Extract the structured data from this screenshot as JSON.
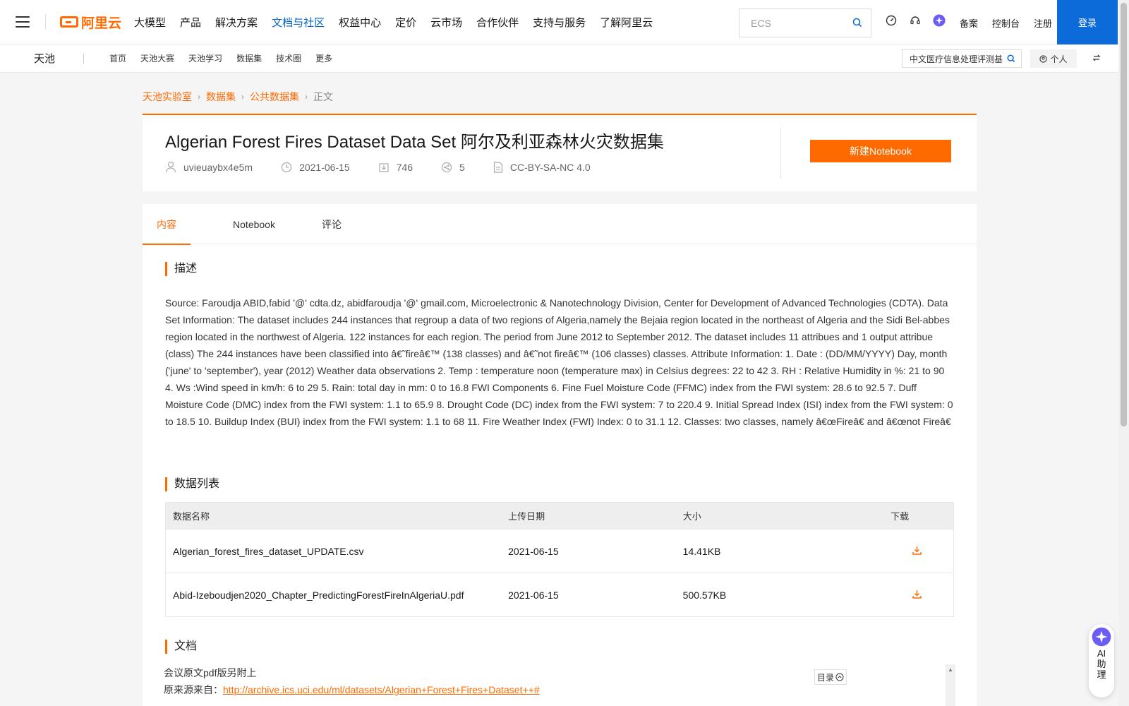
{
  "topnav": {
    "logo_text": "阿里云",
    "items": [
      "大模型",
      "产品",
      "解决方案",
      "文档与社区",
      "权益中心",
      "定价",
      "云市场",
      "合作伙伴",
      "支持与服务",
      "了解阿里云"
    ],
    "search_placeholder": "ECS",
    "links": [
      "备案",
      "控制台",
      "注册"
    ],
    "login_label": "登录"
  },
  "subnav": {
    "brand": "天池",
    "items": [
      "首页",
      "天池大赛",
      "天池学习",
      "数据集",
      "技术圈",
      "更多"
    ],
    "search_value": "中文医疗信息处理评测基",
    "personal_label": "个人"
  },
  "breadcrumb": [
    "天池实验室",
    "数据集",
    "公共数据集",
    "正文"
  ],
  "dataset": {
    "title": "Algerian Forest Fires Dataset Data Set 阿尔及利亚森林火灾数据集",
    "author": "uvieuaybx4e5m",
    "date": "2021-06-15",
    "downloads": "746",
    "shares": "5",
    "license": "CC-BY-SA-NC 4.0",
    "notebook_label": "新建Notebook"
  },
  "tabs": [
    "内容",
    "Notebook",
    "评论"
  ],
  "sections": {
    "description_title": "描述",
    "description_text": "  Source: Faroudja ABID,fabid '@' cdta.dz, abidfaroudja '@' gmail.com, Microelectronic & Nanotechnology Division, Center for Development of Advanced Technologies (CDTA). Data Set Information: The dataset includes 244 instances that regroup a data of two regions of Algeria,namely the Bejaia region located in the northeast of Algeria and the Sidi Bel-abbes region located in the northwest of Algeria. 122 instances for each region. The period from June 2012 to September 2012. The dataset includes 11 attribues and 1 output attribue (class) The 244 instances have been classified into â€˜fireâ€™ (138 classes) and â€˜not fireâ€™ (106 classes) classes. Attribute Information: 1. Date : (DD/MM/YYYY) Day, month ('june' to 'september'), year (2012) Weather data observations 2. Temp : temperature noon (temperature max) in Celsius degrees: 22 to 42 3. RH : Relative Humidity in %: 21 to 90 4. Ws :Wind speed in km/h: 6 to 29 5. Rain: total day in mm: 0 to 16.8 FWI Components 6. Fine Fuel Moisture Code (FFMC) index from the FWI system: 28.6 to 92.5 7. Duff Moisture Code (DMC) index from the FWI system: 1.1 to 65.9 8. Drought Code (DC) index from the FWI system: 7 to 220.4 9. Initial Spread Index (ISI) index from the FWI system: 0 to 18.5 10. Buildup Index (BUI) index from the FWI system: 1.1 to 68 11. Fire Weather Index (FWI) Index: 0 to 31.1 12. Classes: two classes, namely â€œFireâ€ and â€œnot Fireâ€",
    "datalist_title": "数据列表",
    "docs_title": "文档"
  },
  "table": {
    "headers": [
      "数据名称",
      "上传日期",
      "大小",
      "下载"
    ],
    "rows": [
      {
        "name": "Algerian_forest_fires_dataset_UPDATE.csv",
        "date": "2021-06-15",
        "size": "14.41KB"
      },
      {
        "name": "Abid-Izeboudjen2020_Chapter_PredictingForestFireInAlgeriaU.pdf",
        "date": "2021-06-15",
        "size": "500.57KB"
      }
    ]
  },
  "docs": {
    "line1": "会议原文pdf版另附上",
    "line2_prefix": "原来源来自：",
    "link": "http://archive.ics.uci.edu/ml/datasets/Algerian+Forest+Fires+Dataset++#",
    "toc_label": "目录"
  },
  "ai_helper": {
    "label": "AI助理"
  },
  "colors": {
    "accent": "#ff6a00",
    "brand_blue": "#0d6ad9",
    "nav_active": "#0064c8"
  }
}
